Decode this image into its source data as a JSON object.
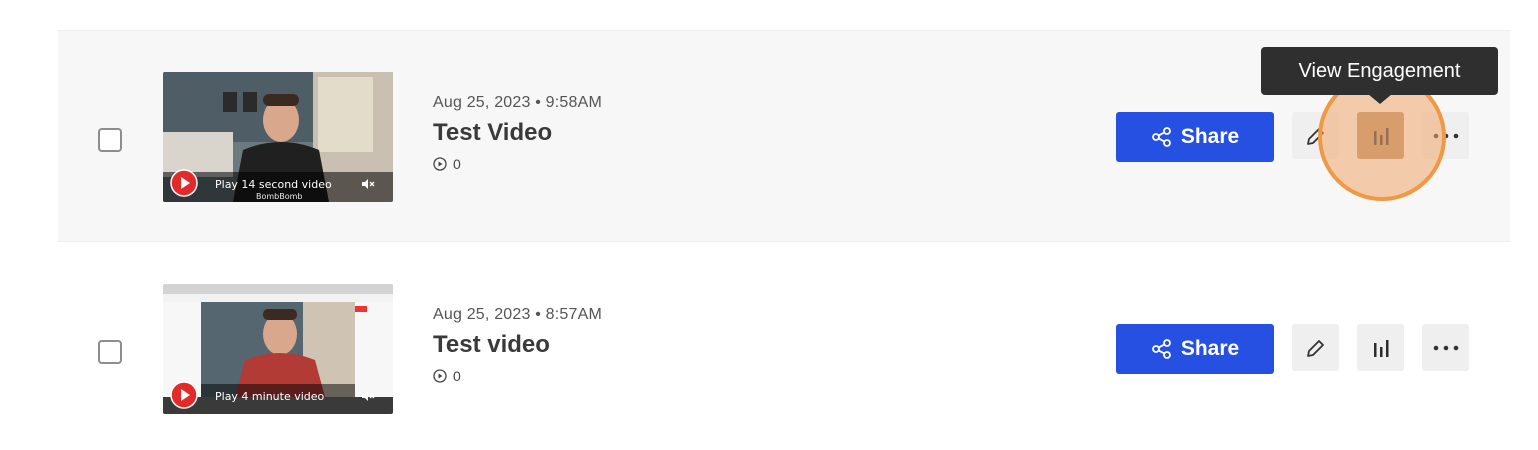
{
  "videos": [
    {
      "date": "Aug 25, 2023 • 9:58AM",
      "title": "Test Video",
      "views": "0",
      "thumbnail_label": "Play 14 second video",
      "brand": "BombBomb",
      "share_label": "Share"
    },
    {
      "date": "Aug 25, 2023 • 8:57AM",
      "title": "Test video",
      "views": "0",
      "thumbnail_label": "Play 4 minute video",
      "share_label": "Share"
    }
  ],
  "tooltip": {
    "text": "View Engagement"
  },
  "colors": {
    "primary": "#2550e2",
    "highlight": "#ef9845",
    "tooltip_bg": "#2f2f2f"
  },
  "icons": [
    "share-icon",
    "pencil-icon",
    "bar-chart-icon",
    "more-icon",
    "play-circle-icon",
    "play-button-icon",
    "mute-icon"
  ]
}
